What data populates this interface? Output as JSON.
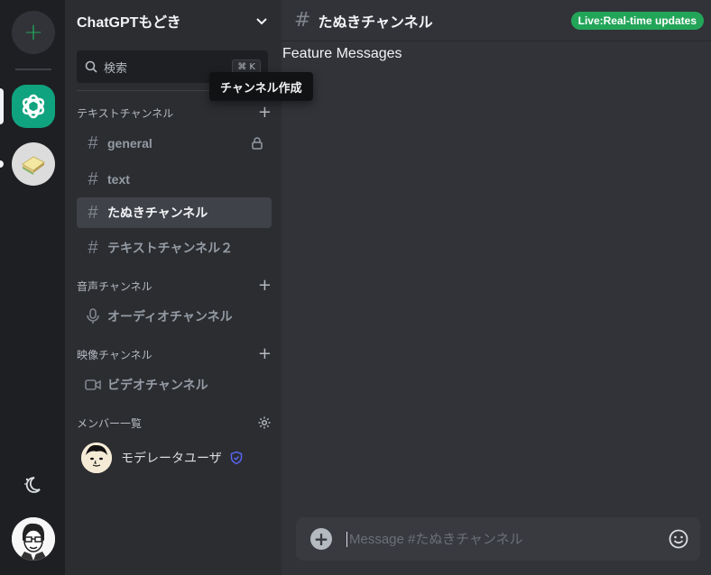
{
  "rail": {
    "add_label": "+"
  },
  "sidebar": {
    "server_name": "ChatGPTもどき",
    "search": {
      "label": "検索",
      "shortcut": "⌘ K"
    },
    "categories": {
      "text": "テキストチャンネル",
      "voice": "音声チャンネル",
      "video": "映像チャンネル",
      "members": "メンバー一覧"
    },
    "channels": {
      "general": "general",
      "text": "text",
      "tanuki": "たぬきチャンネル",
      "text2": "テキストチャンネル２",
      "voice": "オーディオチャンネル",
      "video": "ビデオチャンネル"
    },
    "members": [
      {
        "name": "モデレータユーザ"
      }
    ]
  },
  "tooltip": {
    "text": "チャンネル作成"
  },
  "main": {
    "channel_title": "たぬきチャンネル",
    "live_badge": "Live:Real-time updates",
    "feature_heading": "Feature Messages",
    "composer": {
      "placeholder": "Message #たぬきチャンネル"
    }
  },
  "colors": {
    "accent_green": "#23a559",
    "gpt_brand": "#10a37f",
    "shield_blue": "#5865f2"
  }
}
